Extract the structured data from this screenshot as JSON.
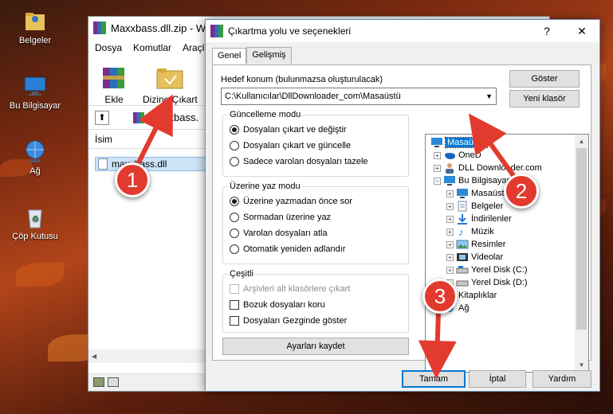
{
  "desktop": {
    "icons": [
      {
        "label": "Belgeler",
        "icon": "documents-folder-icon"
      },
      {
        "label": "Bu Bilgisayar",
        "icon": "computer-icon"
      },
      {
        "label": "Ağ",
        "icon": "network-icon"
      },
      {
        "label": "Çöp Kutusu",
        "icon": "recycle-bin-icon"
      }
    ]
  },
  "winrar": {
    "title": "Maxxbass.dll.zip - W",
    "menu": [
      "Dosya",
      "Komutlar",
      "Araçla"
    ],
    "toolbar": {
      "add_label": "Ekle",
      "extract_label": "Dizine Çıkart"
    },
    "path": "maxxbass.",
    "list_header": "İsim",
    "file_row": "maxxbass.dll"
  },
  "dialog": {
    "title": "Çıkartma yolu ve seçenekleri",
    "tabs": [
      "Genel",
      "Gelişmiş"
    ],
    "dest_label": "Hedef konum (bulunmazsa oluşturulacak)",
    "dest_value": "C:\\Kullanıcılar\\DllDownloader_com\\Masaüstü",
    "show_button": "Göster",
    "new_folder_button": "Yeni klasör",
    "update_group": {
      "title": "Güncelleme modu",
      "options": [
        "Dosyaları çıkart ve değiştir",
        "Dosyaları çıkart ve güncelle",
        "Sadece varolan dosyaları tazele"
      ],
      "selected": 0
    },
    "overwrite_group": {
      "title": "Üzerine yaz modu",
      "options": [
        "Üzerine yazmadan önce sor",
        "Sormadan üzerine yaz",
        "Varolan dosyaları atla",
        "Otomatik yeniden adlandır"
      ],
      "selected": 0
    },
    "misc_group": {
      "title": "Çeşitli",
      "options": [
        "Arşivleri alt klasörlere çıkart",
        "Bozuk dosyaları koru",
        "Dosyaları Gezginde göster"
      ]
    },
    "save_settings_button": "Ayarları kaydet",
    "tree": [
      {
        "label": "Masaüstü",
        "icon": "desktop-icon",
        "selected": true
      },
      {
        "label": "OneD",
        "icon": "onedrive-icon"
      },
      {
        "label": "DLL Downloader.com",
        "icon": "user-icon"
      },
      {
        "label": "Bu Bilgisayar",
        "icon": "computer-icon"
      },
      {
        "label": "Masaüstü",
        "icon": "desktop-icon"
      },
      {
        "label": "Belgeler",
        "icon": "documents-icon"
      },
      {
        "label": "İndirilenler",
        "icon": "downloads-icon"
      },
      {
        "label": "Müzik",
        "icon": "music-icon"
      },
      {
        "label": "Resimler",
        "icon": "pictures-icon"
      },
      {
        "label": "Videolar",
        "icon": "videos-icon"
      },
      {
        "label": "Yerel Disk (C:)",
        "icon": "drive-icon"
      },
      {
        "label": "Yerel Disk (D:)",
        "icon": "drive-icon"
      },
      {
        "label": "Kitaplıklar",
        "icon": "libraries-icon"
      },
      {
        "label": "Ağ",
        "icon": "network-icon"
      }
    ],
    "ok_button": "Tamam",
    "cancel_button": "İptal",
    "help_button": "Yardım"
  },
  "callouts": [
    "1",
    "2",
    "3"
  ],
  "colors": {
    "callout": "#e23a2e",
    "selection": "#0078d7"
  }
}
